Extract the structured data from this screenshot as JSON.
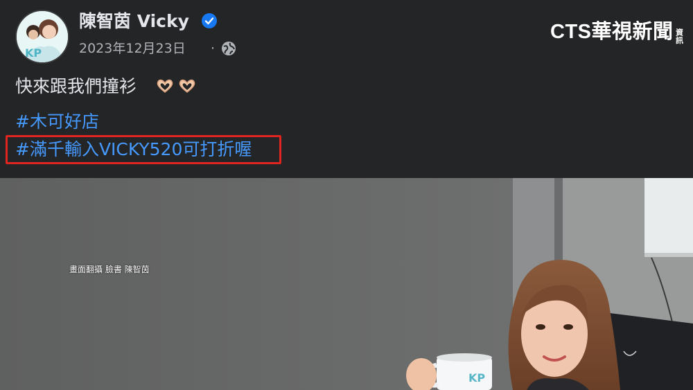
{
  "post": {
    "author_name": "陳智茵 Vicky",
    "date": "2023年12月23日",
    "separator": "·",
    "text": "快來跟我們撞衫",
    "hashtags": [
      "#木可好店",
      "#滿千輸入VICKY520可打折喔"
    ]
  },
  "channel_logo": {
    "main": "CTS華視新聞",
    "side": "資訊"
  },
  "photo": {
    "caption": "畫面翻攝 臉書 陳智茵"
  },
  "icons": {
    "verified": "verified-badge-icon",
    "privacy": "globe-icon",
    "emoji": "heart-hands-icon"
  },
  "colors": {
    "background": "#242526",
    "hashtag": "#4599ff",
    "highlight": "#e0241f",
    "verified": "#1877f2"
  }
}
